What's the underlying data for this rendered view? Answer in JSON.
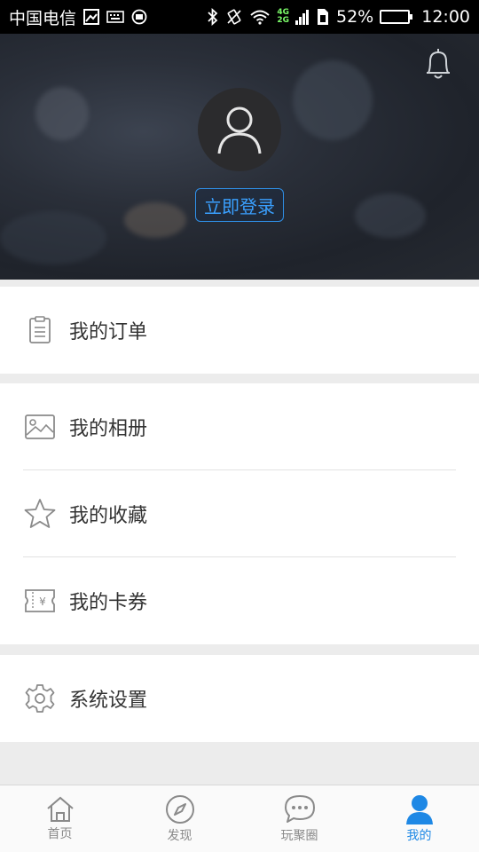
{
  "status_bar": {
    "carrier": "中国电信",
    "net_top": "4G",
    "net_bottom": "2G",
    "battery_level": 0.52,
    "battery_text": "52%",
    "time": "12:00"
  },
  "header": {
    "login_label": "立即登录"
  },
  "menu": {
    "orders": "我的订单",
    "album": "我的相册",
    "favorites": "我的收藏",
    "coupons": "我的卡券",
    "settings": "系统设置"
  },
  "nav": {
    "home": "首页",
    "discover": "发现",
    "circle": "玩聚圈",
    "mine": "我的",
    "active_color": "#1e88e5",
    "inactive_color": "#8a8a8a"
  }
}
